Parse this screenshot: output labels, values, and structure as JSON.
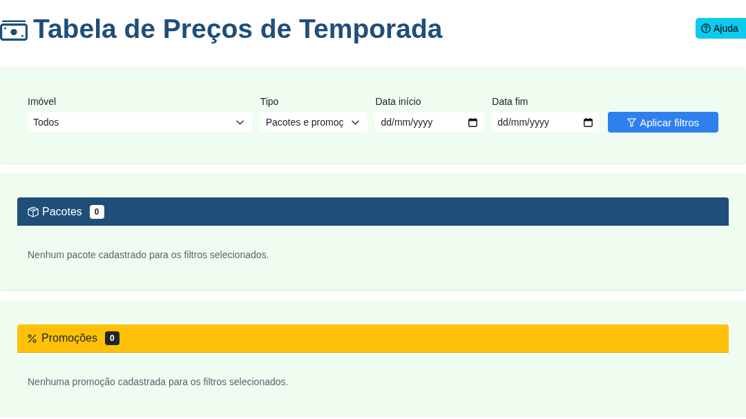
{
  "header": {
    "title": "Tabela de Preços de Temporada",
    "help_button": "Ajuda"
  },
  "filters": {
    "fields": [
      {
        "kind": "select",
        "label": "Imóvel",
        "value": "Todos"
      },
      {
        "kind": "select",
        "label": "Tipo",
        "value": "Pacotes e promoç"
      },
      {
        "kind": "date",
        "label": "Data início",
        "placeholder": "dd/mm/yyyy"
      },
      {
        "kind": "date",
        "label": "Data fim",
        "placeholder": "dd/mm/yyyy"
      }
    ],
    "apply_button": "Aplicar filtros"
  },
  "sections": [
    {
      "kind": "packages",
      "title": "Pacotes",
      "count": "0",
      "empty_message": "Nenhum pacote cadastrado para os filtros selecionados."
    },
    {
      "kind": "promotions",
      "title": "Promoções",
      "count": "0",
      "empty_message": "Nenhuma promoção cadastrada para os filtros selecionados."
    }
  ]
}
